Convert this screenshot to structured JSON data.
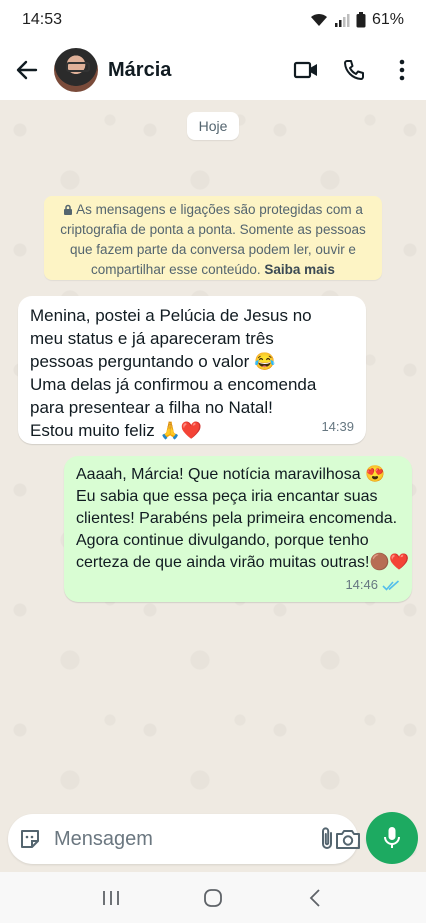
{
  "status_bar": {
    "time": "14:53",
    "battery": "61%"
  },
  "header": {
    "contact_name": "Márcia",
    "icons": [
      "back-arrow-icon",
      "video-call-icon",
      "phone-icon",
      "more-icon"
    ]
  },
  "chat": {
    "date_chip": "Hoje",
    "notice": {
      "text": "As mensagens e ligações são protegidas com a criptografia de ponta a ponta. Somente as pessoas que fazem parte da conversa podem ler, ouvir e compartilhar esse conteúdo.",
      "link": "Saiba mais"
    },
    "messages": [
      {
        "direction": "incoming",
        "lines": [
          "Menina, postei a Pelúcia de Jesus no",
          "meu status e já apareceram três",
          "pessoas perguntando o valor 😂",
          "Uma delas já confirmou a encomenda",
          "para presentear a filha no Natal!",
          "Estou muito feliz 🙏❤️"
        ],
        "time": "14:39"
      },
      {
        "direction": "outgoing",
        "lines": [
          "Aaaah, Márcia! Que notícia maravilhosa 😍",
          "Eu sabia que essa peça iria encantar suas",
          "clientes! Parabéns pela primeira encomenda.",
          "Agora continue divulgando, porque tenho",
          "certeza de que ainda virão muitas outras!🟤❤️"
        ],
        "time": "14:46",
        "status": "read"
      }
    ]
  },
  "composer": {
    "placeholder": "Mensagem"
  },
  "colors": {
    "accent": "#1daa61",
    "outgoing_bubble": "#d9fdd3",
    "notice_bg": "#fdf4c5",
    "chat_bg": "#efeae2",
    "read_ticks": "#53bdeb"
  }
}
